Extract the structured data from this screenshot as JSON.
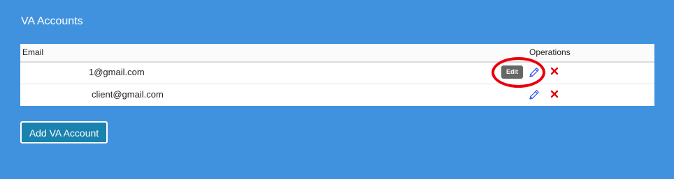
{
  "page": {
    "title": "VA Accounts"
  },
  "table": {
    "columns": [
      "Email",
      "Operations"
    ],
    "rows": [
      {
        "email": "1@gmail.com",
        "tooltip": "Edit"
      },
      {
        "email": "client@gmail.com"
      }
    ]
  },
  "actions": {
    "add_label": "Add VA Account"
  },
  "colors": {
    "background": "#4192de",
    "edit_icon": "#2d4df0",
    "delete_icon": "#e3000b",
    "highlight": "#e8000b",
    "button": "#1a82ae"
  },
  "icons": {
    "edit": "pencil-icon",
    "delete": "close-icon"
  }
}
